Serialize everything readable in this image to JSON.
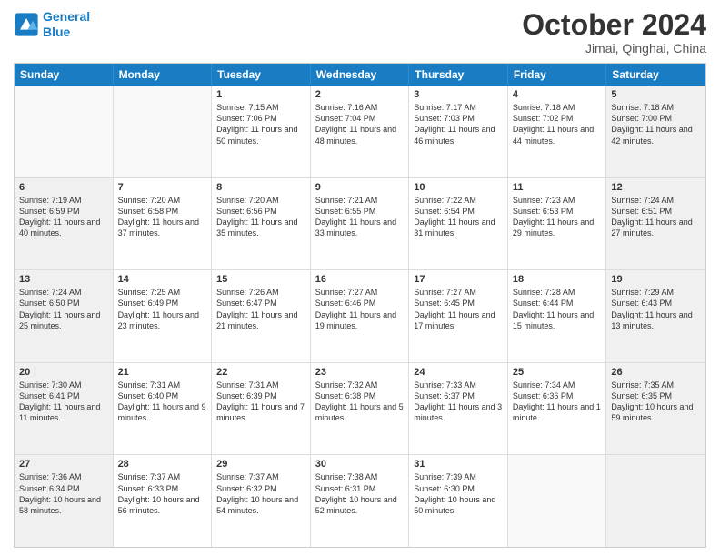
{
  "header": {
    "logo_line1": "General",
    "logo_line2": "Blue",
    "month": "October 2024",
    "location": "Jimai, Qinghai, China"
  },
  "days_of_week": [
    "Sunday",
    "Monday",
    "Tuesday",
    "Wednesday",
    "Thursday",
    "Friday",
    "Saturday"
  ],
  "rows": [
    [
      {
        "day": "",
        "info": "",
        "shaded": false,
        "empty": true
      },
      {
        "day": "",
        "info": "",
        "shaded": false,
        "empty": true
      },
      {
        "day": "1",
        "info": "Sunrise: 7:15 AM\nSunset: 7:06 PM\nDaylight: 11 hours and 50 minutes.",
        "shaded": false,
        "empty": false
      },
      {
        "day": "2",
        "info": "Sunrise: 7:16 AM\nSunset: 7:04 PM\nDaylight: 11 hours and 48 minutes.",
        "shaded": false,
        "empty": false
      },
      {
        "day": "3",
        "info": "Sunrise: 7:17 AM\nSunset: 7:03 PM\nDaylight: 11 hours and 46 minutes.",
        "shaded": false,
        "empty": false
      },
      {
        "day": "4",
        "info": "Sunrise: 7:18 AM\nSunset: 7:02 PM\nDaylight: 11 hours and 44 minutes.",
        "shaded": false,
        "empty": false
      },
      {
        "day": "5",
        "info": "Sunrise: 7:18 AM\nSunset: 7:00 PM\nDaylight: 11 hours and 42 minutes.",
        "shaded": true,
        "empty": false
      }
    ],
    [
      {
        "day": "6",
        "info": "Sunrise: 7:19 AM\nSunset: 6:59 PM\nDaylight: 11 hours and 40 minutes.",
        "shaded": true,
        "empty": false
      },
      {
        "day": "7",
        "info": "Sunrise: 7:20 AM\nSunset: 6:58 PM\nDaylight: 11 hours and 37 minutes.",
        "shaded": false,
        "empty": false
      },
      {
        "day": "8",
        "info": "Sunrise: 7:20 AM\nSunset: 6:56 PM\nDaylight: 11 hours and 35 minutes.",
        "shaded": false,
        "empty": false
      },
      {
        "day": "9",
        "info": "Sunrise: 7:21 AM\nSunset: 6:55 PM\nDaylight: 11 hours and 33 minutes.",
        "shaded": false,
        "empty": false
      },
      {
        "day": "10",
        "info": "Sunrise: 7:22 AM\nSunset: 6:54 PM\nDaylight: 11 hours and 31 minutes.",
        "shaded": false,
        "empty": false
      },
      {
        "day": "11",
        "info": "Sunrise: 7:23 AM\nSunset: 6:53 PM\nDaylight: 11 hours and 29 minutes.",
        "shaded": false,
        "empty": false
      },
      {
        "day": "12",
        "info": "Sunrise: 7:24 AM\nSunset: 6:51 PM\nDaylight: 11 hours and 27 minutes.",
        "shaded": true,
        "empty": false
      }
    ],
    [
      {
        "day": "13",
        "info": "Sunrise: 7:24 AM\nSunset: 6:50 PM\nDaylight: 11 hours and 25 minutes.",
        "shaded": true,
        "empty": false
      },
      {
        "day": "14",
        "info": "Sunrise: 7:25 AM\nSunset: 6:49 PM\nDaylight: 11 hours and 23 minutes.",
        "shaded": false,
        "empty": false
      },
      {
        "day": "15",
        "info": "Sunrise: 7:26 AM\nSunset: 6:47 PM\nDaylight: 11 hours and 21 minutes.",
        "shaded": false,
        "empty": false
      },
      {
        "day": "16",
        "info": "Sunrise: 7:27 AM\nSunset: 6:46 PM\nDaylight: 11 hours and 19 minutes.",
        "shaded": false,
        "empty": false
      },
      {
        "day": "17",
        "info": "Sunrise: 7:27 AM\nSunset: 6:45 PM\nDaylight: 11 hours and 17 minutes.",
        "shaded": false,
        "empty": false
      },
      {
        "day": "18",
        "info": "Sunrise: 7:28 AM\nSunset: 6:44 PM\nDaylight: 11 hours and 15 minutes.",
        "shaded": false,
        "empty": false
      },
      {
        "day": "19",
        "info": "Sunrise: 7:29 AM\nSunset: 6:43 PM\nDaylight: 11 hours and 13 minutes.",
        "shaded": true,
        "empty": false
      }
    ],
    [
      {
        "day": "20",
        "info": "Sunrise: 7:30 AM\nSunset: 6:41 PM\nDaylight: 11 hours and 11 minutes.",
        "shaded": true,
        "empty": false
      },
      {
        "day": "21",
        "info": "Sunrise: 7:31 AM\nSunset: 6:40 PM\nDaylight: 11 hours and 9 minutes.",
        "shaded": false,
        "empty": false
      },
      {
        "day": "22",
        "info": "Sunrise: 7:31 AM\nSunset: 6:39 PM\nDaylight: 11 hours and 7 minutes.",
        "shaded": false,
        "empty": false
      },
      {
        "day": "23",
        "info": "Sunrise: 7:32 AM\nSunset: 6:38 PM\nDaylight: 11 hours and 5 minutes.",
        "shaded": false,
        "empty": false
      },
      {
        "day": "24",
        "info": "Sunrise: 7:33 AM\nSunset: 6:37 PM\nDaylight: 11 hours and 3 minutes.",
        "shaded": false,
        "empty": false
      },
      {
        "day": "25",
        "info": "Sunrise: 7:34 AM\nSunset: 6:36 PM\nDaylight: 11 hours and 1 minute.",
        "shaded": false,
        "empty": false
      },
      {
        "day": "26",
        "info": "Sunrise: 7:35 AM\nSunset: 6:35 PM\nDaylight: 10 hours and 59 minutes.",
        "shaded": true,
        "empty": false
      }
    ],
    [
      {
        "day": "27",
        "info": "Sunrise: 7:36 AM\nSunset: 6:34 PM\nDaylight: 10 hours and 58 minutes.",
        "shaded": true,
        "empty": false
      },
      {
        "day": "28",
        "info": "Sunrise: 7:37 AM\nSunset: 6:33 PM\nDaylight: 10 hours and 56 minutes.",
        "shaded": false,
        "empty": false
      },
      {
        "day": "29",
        "info": "Sunrise: 7:37 AM\nSunset: 6:32 PM\nDaylight: 10 hours and 54 minutes.",
        "shaded": false,
        "empty": false
      },
      {
        "day": "30",
        "info": "Sunrise: 7:38 AM\nSunset: 6:31 PM\nDaylight: 10 hours and 52 minutes.",
        "shaded": false,
        "empty": false
      },
      {
        "day": "31",
        "info": "Sunrise: 7:39 AM\nSunset: 6:30 PM\nDaylight: 10 hours and 50 minutes.",
        "shaded": false,
        "empty": false
      },
      {
        "day": "",
        "info": "",
        "shaded": false,
        "empty": true
      },
      {
        "day": "",
        "info": "",
        "shaded": true,
        "empty": true
      }
    ]
  ]
}
